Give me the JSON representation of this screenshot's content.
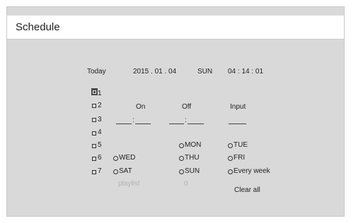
{
  "window": {
    "title": "Schedule"
  },
  "status": {
    "today_label": "Today",
    "date": "2015 . 01 . 04",
    "weekday": "SUN",
    "time": "04 : 14 : 01"
  },
  "schedules": [
    {
      "label": "1",
      "checked": true
    },
    {
      "label": "2",
      "checked": false
    },
    {
      "label": "3",
      "checked": false
    },
    {
      "label": "4",
      "checked": false
    },
    {
      "label": "5",
      "checked": false
    },
    {
      "label": "6",
      "checked": false
    },
    {
      "label": "7",
      "checked": false
    }
  ],
  "columns": {
    "on": "On",
    "off": "Off",
    "input": "Input"
  },
  "time_separator": ":",
  "days": {
    "mon": "MON",
    "tue": "TUE",
    "wed": "WED",
    "thu": "THU",
    "fri": "FRI",
    "sat": "SAT",
    "sun": "SUN",
    "every_week": "Every week"
  },
  "playlist": {
    "label": "playlist",
    "value": "0"
  },
  "clear_all": "Clear all"
}
